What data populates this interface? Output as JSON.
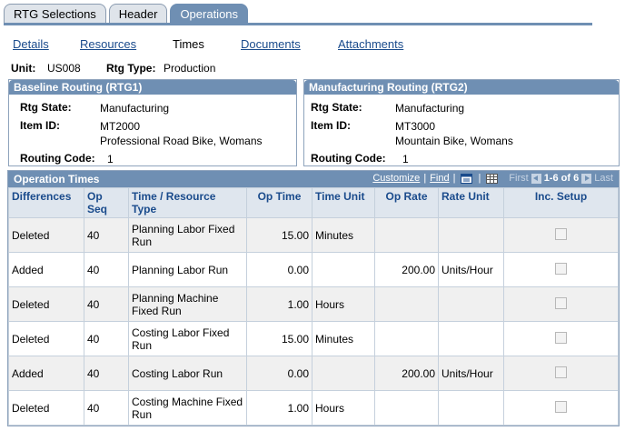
{
  "tabs": [
    {
      "label": "RTG Selections",
      "active": false
    },
    {
      "label": "Header",
      "active": false
    },
    {
      "label": "Operations",
      "active": true
    }
  ],
  "subnav": {
    "details": "Details",
    "resources": "Resources",
    "times": "Times",
    "documents": "Documents",
    "attachments": "Attachments"
  },
  "unit": {
    "unit_label": "Unit:",
    "unit_value": "US008",
    "rtg_type_label": "Rtg Type:",
    "rtg_type_value": "Production"
  },
  "baseline": {
    "title": "Baseline Routing (RTG1)",
    "rtg_state_label": "Rtg State:",
    "rtg_state_value": "Manufacturing",
    "item_id_label": "Item ID:",
    "item_id_value": "MT2000",
    "item_desc": "Professional Road Bike, Womans",
    "routing_code_label": "Routing Code:",
    "routing_code_value": "1"
  },
  "manufacturing": {
    "title": "Manufacturing Routing (RTG2)",
    "rtg_state_label": "Rtg State:",
    "rtg_state_value": "Manufacturing",
    "item_id_label": "Item ID:",
    "item_id_value": "MT3000",
    "item_desc": "Mountain Bike, Womans",
    "routing_code_label": "Routing Code:",
    "routing_code_value": "1"
  },
  "grid": {
    "title": "Operation Times",
    "customize": "Customize",
    "sep": "|",
    "find": "Find",
    "first": "First",
    "range": "1-6 of 6",
    "last": "Last",
    "headers": {
      "differences": "Differences",
      "op_seq_1": "Op",
      "op_seq_2": "Seq",
      "time_res_1": "Time / Resource",
      "time_res_2": "Type",
      "op_time": "Op Time",
      "time_unit": "Time Unit",
      "op_rate": "Op Rate",
      "rate_unit": "Rate Unit",
      "inc_setup": "Inc. Setup"
    },
    "rows": [
      {
        "diff": "Deleted",
        "seq": "40",
        "type": "Planning Labor Fixed Run",
        "op_time": "15.00",
        "time_unit": "Minutes",
        "op_rate": "",
        "rate_unit": ""
      },
      {
        "diff": "Added",
        "seq": "40",
        "type": "Planning Labor Run",
        "op_time": "0.00",
        "time_unit": "",
        "op_rate": "200.00",
        "rate_unit": "Units/Hour"
      },
      {
        "diff": "Deleted",
        "seq": "40",
        "type": "Planning Machine Fixed Run",
        "op_time": "1.00",
        "time_unit": "Hours",
        "op_rate": "",
        "rate_unit": ""
      },
      {
        "diff": "Deleted",
        "seq": "40",
        "type": "Costing Labor Fixed Run",
        "op_time": "15.00",
        "time_unit": "Minutes",
        "op_rate": "",
        "rate_unit": ""
      },
      {
        "diff": "Added",
        "seq": "40",
        "type": "Costing Labor Run",
        "op_time": "0.00",
        "time_unit": "",
        "op_rate": "200.00",
        "rate_unit": "Units/Hour"
      },
      {
        "diff": "Deleted",
        "seq": "40",
        "type": "Costing Machine Fixed Run",
        "op_time": "1.00",
        "time_unit": "Hours",
        "op_rate": "",
        "rate_unit": ""
      }
    ]
  },
  "colors": {
    "header_blue": "#6f8fb3",
    "link_blue": "#1a4b8c",
    "col_header_bg": "#dfe6ee"
  }
}
